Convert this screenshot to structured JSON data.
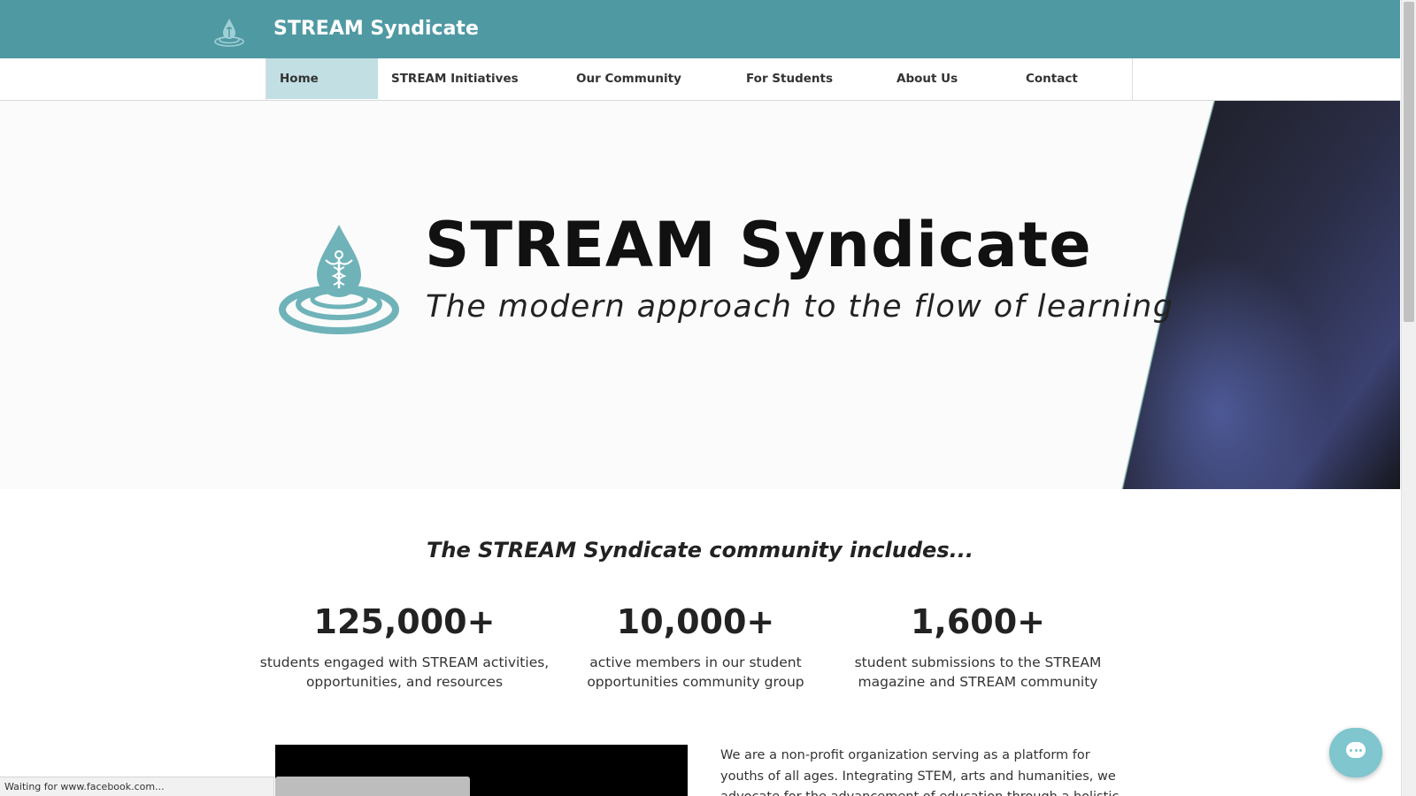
{
  "header": {
    "site_title": "STREAM Syndicate",
    "logo_icon": "water-drop-caduceus-logo"
  },
  "nav": {
    "items": [
      {
        "label": "Home",
        "active": true
      },
      {
        "label": "STREAM Initiatives",
        "active": false
      },
      {
        "label": "Our Community",
        "active": false
      },
      {
        "label": "For Students",
        "active": false
      },
      {
        "label": "About Us",
        "active": false
      },
      {
        "label": "Contact",
        "active": false
      }
    ]
  },
  "hero": {
    "title": "STREAM Syndicate",
    "subtitle": "The modern approach to the flow of learning"
  },
  "community": {
    "heading": "The STREAM Syndicate community includes...",
    "stats": [
      {
        "number": "125,000+",
        "description": "students engaged with STREAM activities, opportunities, and resources"
      },
      {
        "number": "10,000+",
        "description": "active members in our student opportunities community group"
      },
      {
        "number": "1,600+",
        "description": "student submissions to the STREAM magazine and STREAM community"
      }
    ]
  },
  "about": {
    "text": "We are a non-profit organization serving as a platform for youths of all ages. Integrating STEM, arts and humanities, we advocate for the advancement of education through a holistic and modern"
  },
  "status_bar": {
    "text": "Waiting for www.facebook.com..."
  },
  "colors": {
    "brand_teal": "#4f99a3",
    "nav_active": "#c2dfe3",
    "logo_teal": "#6fb3b9"
  }
}
